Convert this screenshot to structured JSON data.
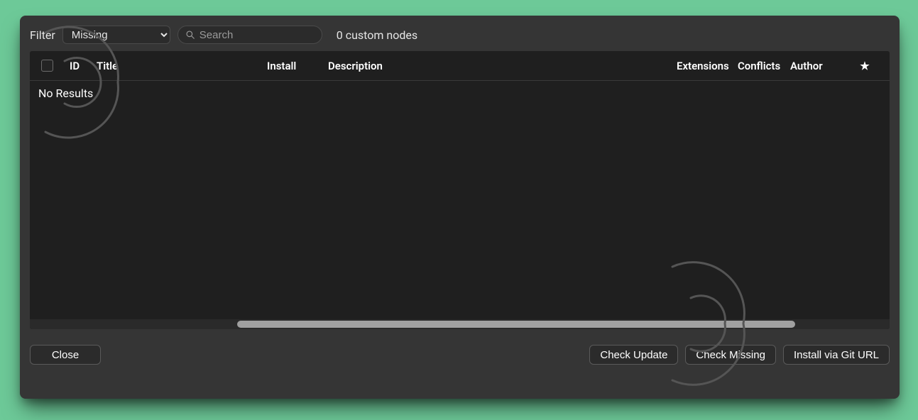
{
  "topbar": {
    "filter_label": "Filter",
    "filter_selected": "Missing",
    "filter_options": [
      "Missing"
    ],
    "search_placeholder": "Search",
    "search_value": "",
    "status_text": "0 custom nodes"
  },
  "table": {
    "columns": {
      "id": "ID",
      "title": "Title",
      "install": "Install",
      "description": "Description",
      "extensions": "Extensions",
      "conflicts": "Conflicts",
      "author": "Author"
    },
    "rows": [],
    "empty_text": "No Results"
  },
  "footer": {
    "close": "Close",
    "check_update": "Check Update",
    "check_missing": "Check Missing",
    "install_git_url": "Install via Git URL"
  },
  "colors": {
    "page_bg": "#6dc998",
    "dialog_bg": "#353535",
    "panel_bg": "#1f1f1f",
    "control_bg": "#2b2b2b"
  }
}
